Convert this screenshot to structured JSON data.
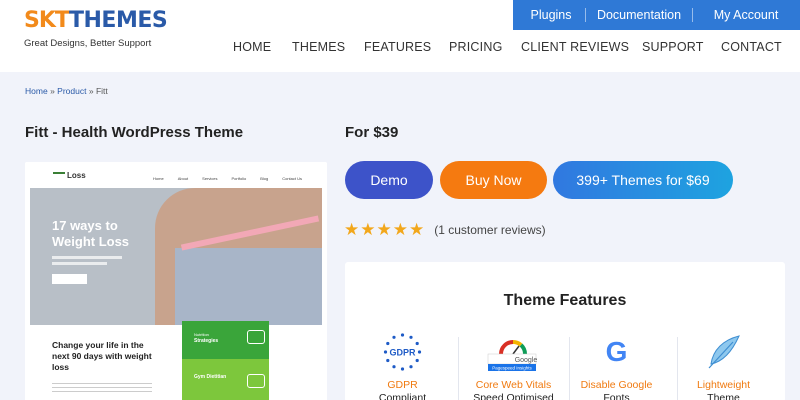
{
  "brand": {
    "logo_mark": "SKT",
    "logo_word": "THEMES",
    "tagline": "Great Designs, Better Support"
  },
  "topbar": {
    "items": [
      "Plugins",
      "Documentation",
      "My Account"
    ],
    "color": "#2f79d6"
  },
  "nav": {
    "items": [
      "HOME",
      "THEMES",
      "FEATURES",
      "PRICING",
      "CLIENT REVIEWS",
      "SUPPORT",
      "CONTACT"
    ]
  },
  "breadcrumb": {
    "home": "Home",
    "sep1": "»",
    "product": "Product",
    "sep2": "»",
    "current": "Fitt"
  },
  "product": {
    "title": "Fitt - Health WordPress Theme",
    "price": "For $39"
  },
  "preview": {
    "logo": "Loss",
    "nav": [
      "Home",
      "About",
      "Services",
      "Portfolio",
      "Blog",
      "Contact Us"
    ],
    "hero_title_line1": "17 ways to",
    "hero_title_line2": "Weight Loss",
    "bottom_title": "Change your life in the next 90 days with weight loss",
    "card1_small": "Nutrition",
    "card1_title": "Strategies",
    "card2_title": "Gym Dietitian"
  },
  "buttons": {
    "demo": "Demo",
    "buy": "Buy Now",
    "bundle": "399+ Themes for $69"
  },
  "rating": {
    "stars": 5,
    "star_glyph": "★",
    "reviews": "(1 customer reviews)"
  },
  "features": {
    "title": "Theme Features",
    "items": [
      {
        "label": "GDPR",
        "sub": "Compliant",
        "icon": "gdpr-icon"
      },
      {
        "label": "Core Web Vitals",
        "sub": "Speed Optimised",
        "icon": "pagespeed-icon"
      },
      {
        "label": "Disable Google",
        "sub": "Fonts",
        "icon": "google-icon"
      },
      {
        "label": "Lightweight",
        "sub": "Theme",
        "icon": "feather-icon"
      }
    ],
    "gdpr_text": "GDPR",
    "pagespeed_text": "Google",
    "pagespeed_badge": "Pagespeed Insights",
    "google_letter": "G"
  },
  "colors": {
    "accent_orange": "#f57a10",
    "accent_blue": "#3d53c9",
    "brand_blue": "#2a5aa8"
  }
}
